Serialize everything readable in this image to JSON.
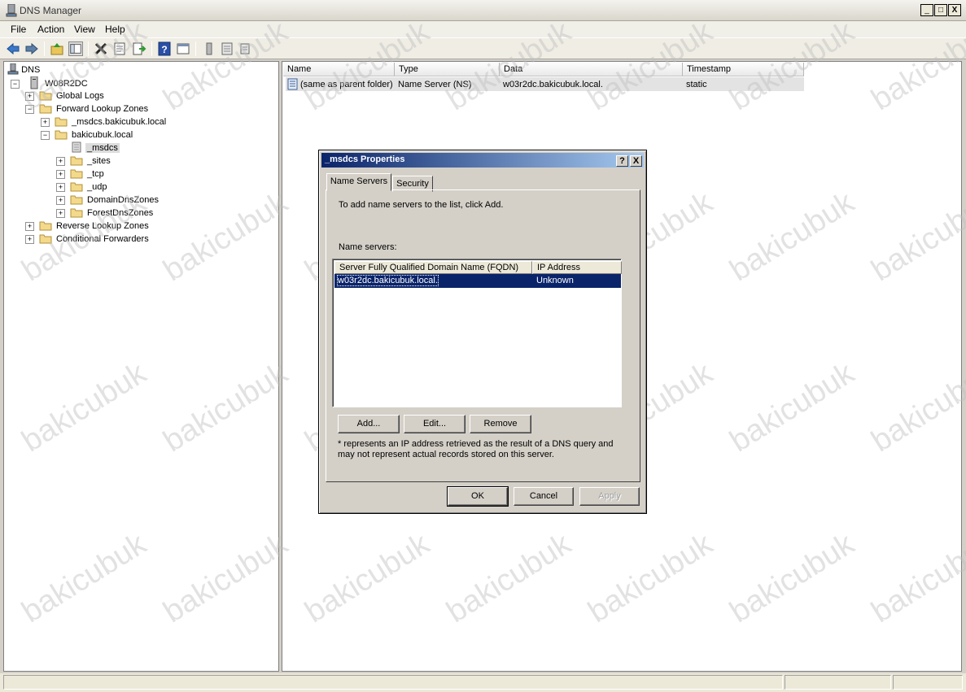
{
  "window": {
    "title": "DNS Manager",
    "buttons": [
      "_",
      "□",
      "X"
    ]
  },
  "menu": [
    "File",
    "Action",
    "View",
    "Help"
  ],
  "toolbar_icons": [
    "back-arrow-icon",
    "forward-arrow-icon",
    "up-folder-icon",
    "show-hide-tree-icon",
    "delete-icon",
    "properties-icon",
    "export-list-icon",
    "help-icon",
    "console-icon",
    "server-icon",
    "zone-icon",
    "record-icon"
  ],
  "tree": {
    "root": "DNS",
    "server": "W08R2DC",
    "items": [
      {
        "label": "Global Logs",
        "level": 2,
        "expander": "+"
      },
      {
        "label": "Forward Lookup Zones",
        "level": 2,
        "expander": "-"
      },
      {
        "label": "_msdcs.bakicubuk.local",
        "level": 3,
        "expander": "+"
      },
      {
        "label": "bakicubuk.local",
        "level": 3,
        "expander": "-"
      },
      {
        "label": "_msdcs",
        "level": 4,
        "expander": "",
        "selected": true
      },
      {
        "label": "_sites",
        "level": 4,
        "expander": "+"
      },
      {
        "label": "_tcp",
        "level": 4,
        "expander": "+"
      },
      {
        "label": "_udp",
        "level": 4,
        "expander": "+"
      },
      {
        "label": "DomainDnsZones",
        "level": 4,
        "expander": "+"
      },
      {
        "label": "ForestDnsZones",
        "level": 4,
        "expander": "+"
      },
      {
        "label": "Reverse Lookup Zones",
        "level": 2,
        "expander": "+"
      },
      {
        "label": "Conditional Forwarders",
        "level": 2,
        "expander": "+"
      }
    ]
  },
  "list": {
    "columns": [
      "Name",
      "Type",
      "Data",
      "Timestamp"
    ],
    "rows": [
      {
        "name": "(same as parent folder)",
        "type": "Name Server (NS)",
        "data": "w03r2dc.bakicubuk.local.",
        "timestamp": "static"
      }
    ]
  },
  "dialog": {
    "title": "_msdcs Properties",
    "help_button": "?",
    "close_button": "X",
    "tabs": [
      "Name Servers",
      "Security"
    ],
    "instruction": "To add name servers to the list, click Add.",
    "list_label": "Name servers:",
    "columns": [
      "Server Fully Qualified Domain Name (FQDN)",
      "IP Address"
    ],
    "rows": [
      {
        "fqdn": "w03r2dc.bakicubuk.local.",
        "ip": "Unknown"
      }
    ],
    "add": "Add...",
    "edit": "Edit...",
    "remove": "Remove",
    "note": "* represents an IP address retrieved as the result of a DNS query and may not represent actual records stored on this server.",
    "ok": "OK",
    "cancel": "Cancel",
    "apply": "Apply"
  },
  "watermark": "bakicubuk"
}
